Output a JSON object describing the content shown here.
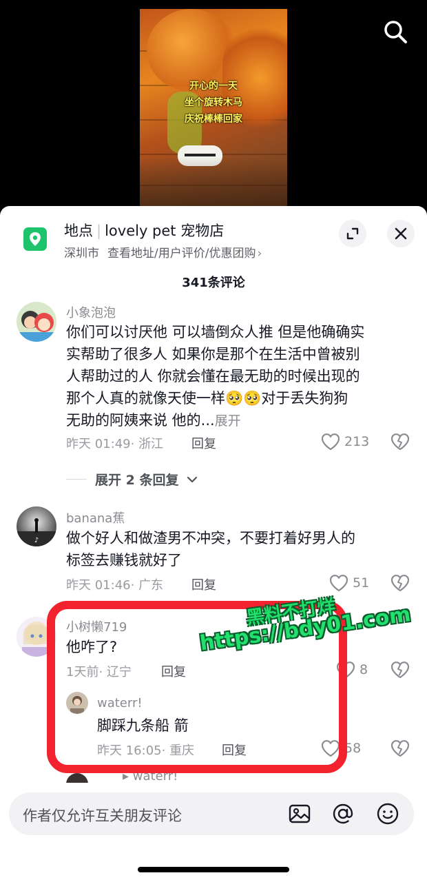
{
  "video": {
    "caption_lines": [
      "开心的一天",
      "坐个旋转木马",
      "庆祝棒棒回家"
    ],
    "search_icon": "search-icon"
  },
  "poi": {
    "label": "地点",
    "name": "lovely pet 宠物店",
    "city": "深圳市",
    "links": "查看地址/用户评价/优惠团购",
    "chevron": "›",
    "icon": "location-pin-icon",
    "accent": "#1ec46b"
  },
  "comments_header": {
    "count": "341条评论"
  },
  "comments": [
    {
      "username": "小象泡泡",
      "lines": [
        "你们可以讨厌他 可以墙倒众人推 但是他确确实",
        "实帮助了很多人 如果你是那个在生活中曾被别",
        "人帮助过的人 你就会懂在最无助的时候出现的",
        "那个人真的就像天使一样🥺🥺对于丢失狗狗",
        "无助的阿姨来说 他的..."
      ],
      "more": "展开",
      "time": "昨天 01:49",
      "location": "浙江",
      "reply": "回复",
      "likes": "213"
    },
    {
      "username": "banana蕉",
      "lines": [
        "做个好人和做渣男不冲突，不要打着好男人的",
        "标签去赚钱就好了"
      ],
      "time": "昨天 01:46",
      "location": "广东",
      "reply": "回复",
      "likes": "51"
    },
    {
      "username": "小树懒719",
      "lines": [
        "他咋了?"
      ],
      "time": "1天前",
      "location": "辽宁",
      "reply": "回复",
      "likes": "8"
    }
  ],
  "expand_replies": {
    "label": "展开 2 条回复",
    "icon": "chevron-down-icon"
  },
  "nested_reply": {
    "username": "waterr!",
    "text": "脚踩九条船 箭",
    "time": "昨天 16:05",
    "location": "重庆",
    "reply": "回复",
    "likes": "58"
  },
  "peek_reply": {
    "username": "waterr!"
  },
  "watermark": {
    "line1": "黑料不打烊",
    "line2": "https://bdy01.com"
  },
  "input": {
    "placeholder": "作者仅允许互关朋友评论",
    "icons": [
      "image-icon",
      "at-icon",
      "emoji-icon"
    ]
  },
  "colors": {
    "highlight": "#f2232f",
    "watermark": "#1ee06b"
  }
}
